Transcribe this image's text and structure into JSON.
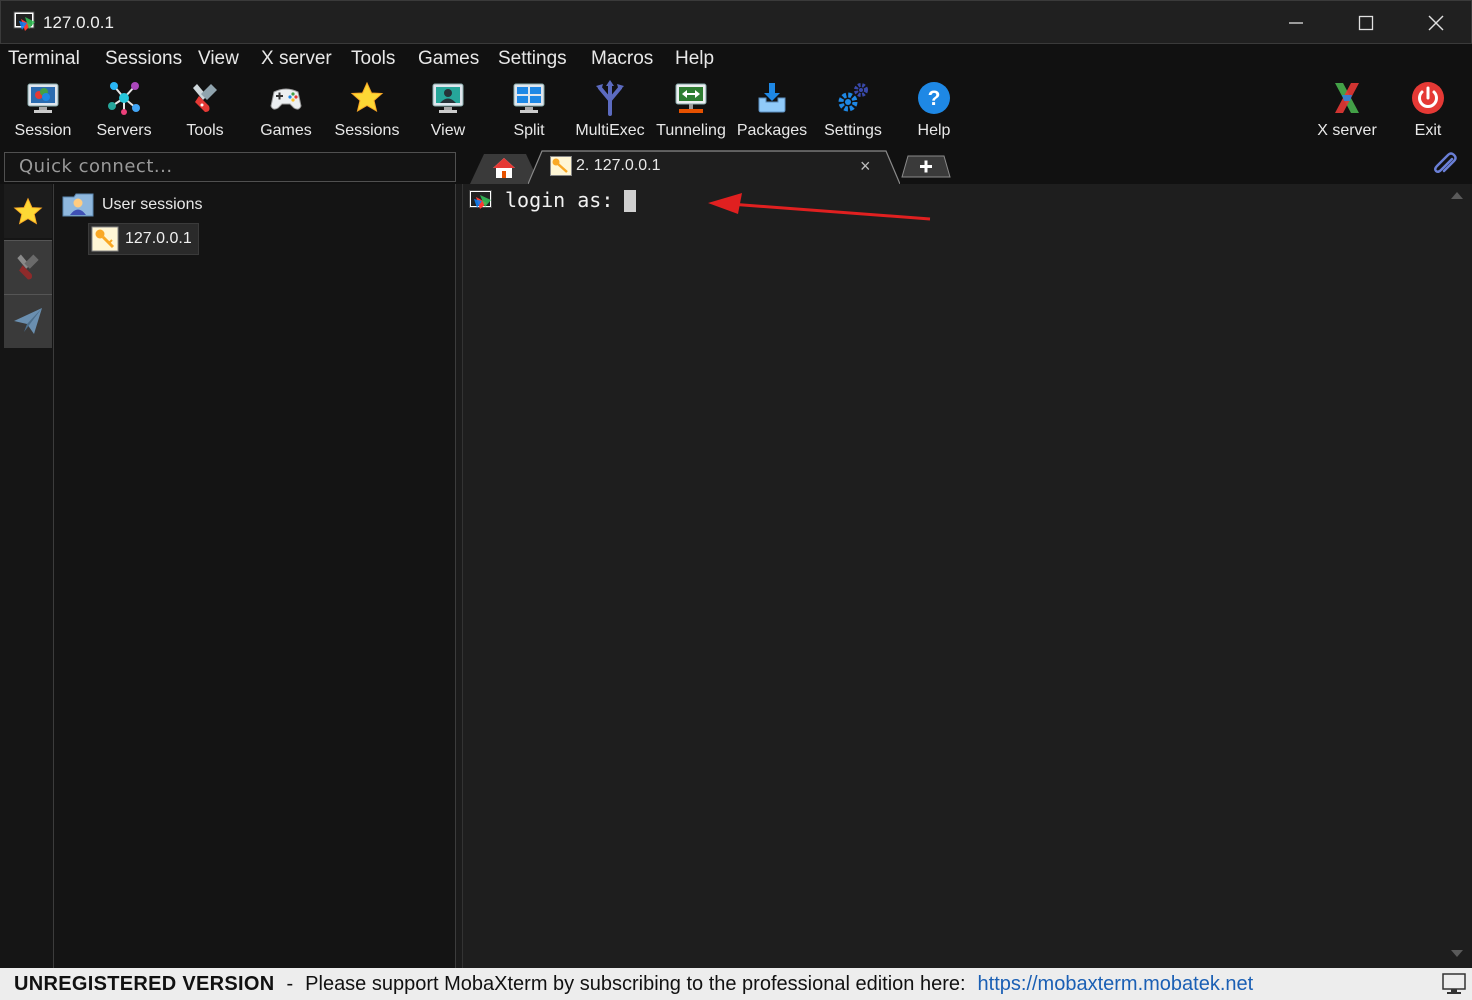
{
  "window": {
    "title": "127.0.0.1"
  },
  "menu": [
    "Terminal",
    "Sessions",
    "View",
    "X server",
    "Tools",
    "Games",
    "Settings",
    "Macros",
    "Help"
  ],
  "toolbar": {
    "left": [
      {
        "label": "Session",
        "icon": "session-monitor-icon"
      },
      {
        "label": "Servers",
        "icon": "servers-network-icon"
      },
      {
        "label": "Tools",
        "icon": "tools-knife-icon"
      },
      {
        "label": "Games",
        "icon": "gamepad-icon"
      },
      {
        "label": "Sessions",
        "icon": "star-icon"
      },
      {
        "label": "View",
        "icon": "view-monitor-icon"
      },
      {
        "label": "Split",
        "icon": "split-grid-icon"
      },
      {
        "label": "MultiExec",
        "icon": "multiexec-fork-icon"
      },
      {
        "label": "Tunneling",
        "icon": "tunneling-icon"
      },
      {
        "label": "Packages",
        "icon": "packages-download-icon"
      },
      {
        "label": "Settings",
        "icon": "settings-gears-icon"
      },
      {
        "label": "Help",
        "icon": "help-icon"
      }
    ],
    "right": [
      {
        "label": "X server",
        "icon": "xserver-icon"
      },
      {
        "label": "Exit",
        "icon": "power-icon"
      }
    ]
  },
  "quick_connect": {
    "placeholder": "Quick connect..."
  },
  "tabs": {
    "session_label": "2. 127.0.0.1",
    "close_glyph": "×"
  },
  "sessions_tree": {
    "folder": "User sessions",
    "items": [
      {
        "label": "127.0.0.1"
      }
    ]
  },
  "terminal": {
    "prompt": "login as:"
  },
  "statusbar": {
    "unregistered": "UNREGISTERED VERSION",
    "separator": "-",
    "message": "Please support MobaXterm by subscribing to the professional edition here:",
    "link": "https://mobaxterm.mobatek.net"
  },
  "colors": {
    "background": "#1e1e1e",
    "toolbar_bg": "#111111",
    "statusbar_bg": "#ededed",
    "link": "#1a5fb4",
    "annotation_arrow": "#e02020",
    "exit_red": "#e53935",
    "help_blue": "#1e88e5"
  }
}
